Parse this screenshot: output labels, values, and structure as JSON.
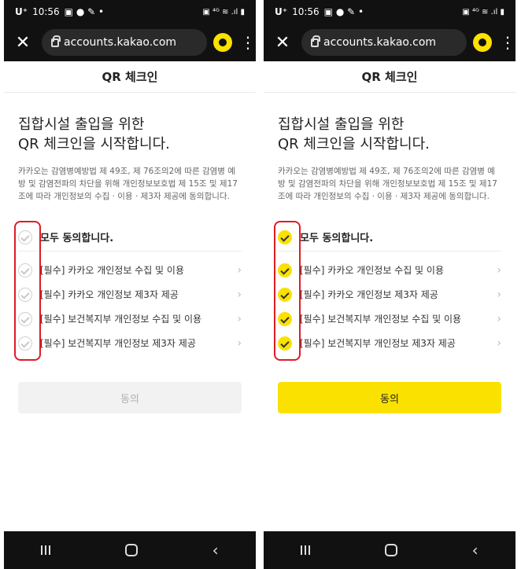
{
  "status": {
    "carrier": "U⁺",
    "time": "10:56",
    "icons": "▣ ● ✎ •",
    "right": "▣ ⁴ᴳ ≋ .ıl ▮"
  },
  "browser": {
    "close_icon": "✕",
    "url": "accounts.kakao.com",
    "menu_icon": "⋮"
  },
  "page": {
    "title": "QR 체크인",
    "headline_line1": "집합시설 출입을 위한",
    "headline_line2": "QR 체크인을 시작합니다.",
    "description": "카카오는 감염병예방법 제 49조, 제 76조의2에 따른 감염병 예방 및 감염전파의 차단을 위해 개인정보보호법 제 15조 및 제17조에 따라 개인정보의 수집 · 이용 · 제3자 제공에 동의합니다.",
    "agree_all": "모두 동의합니다.",
    "items": [
      "[필수] 카카오 개인정보 수집 및 이용",
      "[필수] 카카오 개인정보 제3자 제공",
      "[필수] 보건복지부 개인정보 수집 및 이용",
      "[필수] 보건복지부 개인정보 제3자 제공"
    ],
    "chevron": "›",
    "button_label": "동의"
  },
  "screens": [
    {
      "id": "before",
      "checked": false,
      "button_enabled": false
    },
    {
      "id": "after",
      "checked": true,
      "button_enabled": true
    }
  ],
  "colors": {
    "kakao_yellow": "#fae100",
    "highlight_red": "#e01b24"
  },
  "navbar": {
    "back_icon": "‹"
  }
}
